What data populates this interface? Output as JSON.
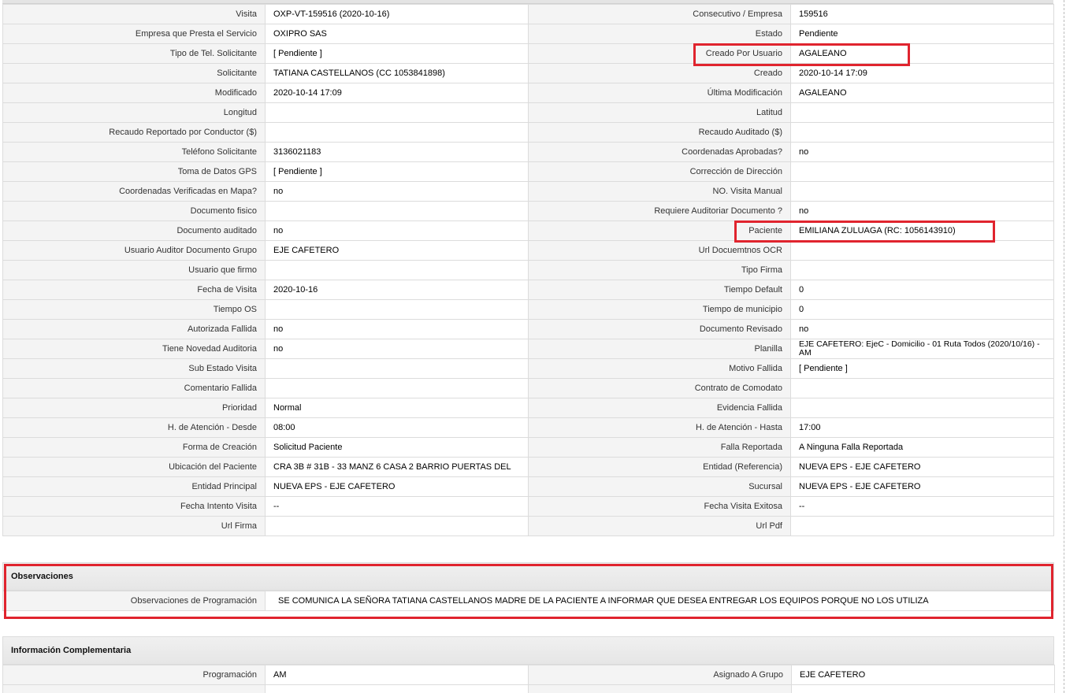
{
  "rows": [
    {
      "l1": "Visita",
      "v1": "OXP-VT-159516 (2020-10-16)",
      "l2": "Consecutivo / Empresa",
      "v2": "159516"
    },
    {
      "l1": "Empresa que Presta el Servicio",
      "v1": "OXIPRO SAS",
      "l2": "Estado",
      "v2": "Pendiente"
    },
    {
      "l1": "Tipo de Tel. Solicitante",
      "v1": "[ Pendiente ]",
      "l2": "Creado Por Usuario",
      "v2": "AGALEANO"
    },
    {
      "l1": "Solicitante",
      "v1": "TATIANA CASTELLANOS (CC 1053841898)",
      "l2": "Creado",
      "v2": "2020-10-14 17:09"
    },
    {
      "l1": "Modificado",
      "v1": "2020-10-14 17:09",
      "l2": "Última Modificación",
      "v2": " AGALEANO"
    },
    {
      "l1": "Longitud",
      "v1": "",
      "l2": "Latitud",
      "v2": ""
    },
    {
      "l1": "Recaudo Reportado por Conductor ($)",
      "v1": "",
      "l2": "Recaudo Auditado ($)",
      "v2": ""
    },
    {
      "l1": "Teléfono Solicitante",
      "v1": "3136021183",
      "l2": "Coordenadas Aprobadas?",
      "v2": " no"
    },
    {
      "l1": "Toma de Datos GPS",
      "v1": "[ Pendiente ]",
      "l2": "Corrección de Dirección",
      "v2": ""
    },
    {
      "l1": "Coordenadas Verificadas en Mapa?",
      "v1": " no",
      "l2": "NO. Visita Manual",
      "v2": ""
    },
    {
      "l1": "Documento fisico",
      "v1": "",
      "l2": "Requiere Auditoriar Documento ?",
      "v2": " no"
    },
    {
      "l1": "Documento auditado",
      "v1": " no",
      "l2": "Paciente",
      "v2": "EMILIANA ZULUAGA (RC: 1056143910)"
    },
    {
      "l1": "Usuario Auditor Documento Grupo",
      "v1": "EJE CAFETERO",
      "l2": "Url Docuemtnos OCR",
      "v2": ""
    },
    {
      "l1": "Usuario que firmo",
      "v1": "",
      "l2": "Tipo Firma",
      "v2": ""
    },
    {
      "l1": "Fecha de Visita",
      "v1": " 2020-10-16",
      "l2": "Tiempo Default",
      "v2": "0"
    },
    {
      "l1": "Tiempo OS",
      "v1": "",
      "l2": "Tiempo de municipio",
      "v2": "0"
    },
    {
      "l1": "Autorizada Fallida",
      "v1": " no",
      "l2": "Documento Revisado",
      "v2": " no"
    },
    {
      "l1": "Tiene Novedad Auditoria",
      "v1": " no",
      "l2": "Planilla",
      "v2": "EJE CAFETERO: EjeC - Domicilio - 01 Ruta Todos (2020/10/16) - AM"
    },
    {
      "l1": "Sub Estado Visita",
      "v1": "",
      "l2": "Motivo Fallida",
      "v2": "[ Pendiente ]"
    },
    {
      "l1": "Comentario Fallida",
      "v1": "",
      "l2": "Contrato de Comodato",
      "v2": ""
    },
    {
      "l1": "Prioridad",
      "v1": "Normal",
      "l2": "Evidencia Fallida",
      "v2": ""
    },
    {
      "l1": "H. de Atención - Desde",
      "v1": "08:00",
      "l2": "H. de Atención - Hasta",
      "v2": "17:00"
    },
    {
      "l1": "Forma de Creación",
      "v1": "Solicitud Paciente",
      "l2": "Falla Reportada",
      "v2": "A Ninguna Falla Reportada"
    },
    {
      "l1": "Ubicación del Paciente",
      "v1": "CRA 3B # 31B - 33 MANZ 6 CASA 2 BARRIO PUERTAS DEL",
      "l2": "Entidad (Referencia)",
      "v2": "NUEVA EPS - EJE CAFETERO"
    },
    {
      "l1": "Entidad Principal",
      "v1": "NUEVA EPS - EJE CAFETERO",
      "l2": "Sucursal",
      "v2": "NUEVA EPS - EJE CAFETERO"
    },
    {
      "l1": "Fecha Intento Visita",
      "v1": "--",
      "l2": "Fecha Visita Exitosa",
      "v2": "--"
    },
    {
      "l1": "Url Firma",
      "v1": "",
      "l2": "Url Pdf",
      "v2": ""
    }
  ],
  "observaciones": {
    "title": "Observaciones",
    "label": "Observaciones de Programación",
    "value": "SE COMUNICA LA SEÑORA TATIANA CASTELLANOS MADRE DE LA PACIENTE A INFORMAR QUE DESEA ENTREGAR LOS EQUIPOS PORQUE NO LOS UTILIZA"
  },
  "complementaria": {
    "title": "Información Complementaria",
    "rows": [
      {
        "l1": "Programación",
        "v1": "AM",
        "l2": "Asignado A Grupo",
        "v2": "EJE CAFETERO"
      }
    ]
  },
  "highlight_color": "#e0242e"
}
